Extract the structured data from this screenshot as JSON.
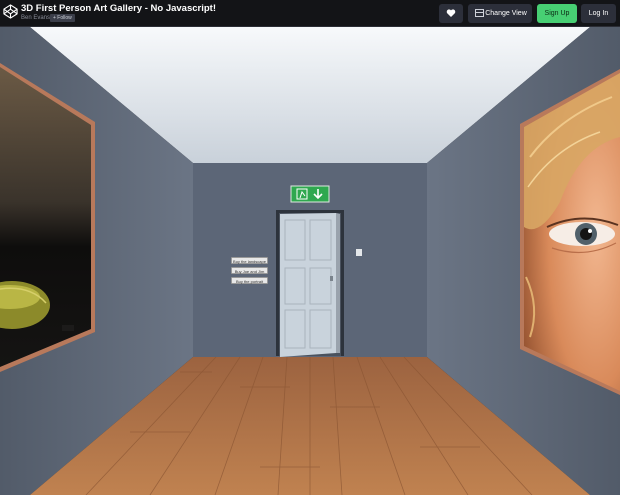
{
  "header": {
    "title": "3D First Person Art Gallery - No Javascript!",
    "author": "Ben Evans",
    "follow_label": "+ Follow",
    "change_view_label": "Change View",
    "signup_label": "Sign Up",
    "login_label": "Log In"
  },
  "gallery": {
    "buttons": [
      "Buy the landscape",
      "Buy Joe and Jim",
      "Buy the portrait"
    ]
  },
  "colors": {
    "signup": "#47cf73",
    "header_bg": "#131417",
    "exit_sign": "#2fa84f",
    "wall": "#5f6a7b",
    "floor": "#b87a4b"
  },
  "icons": [
    "codepen-logo-icon",
    "heart-icon",
    "layout-icon",
    "exit-sign-icon"
  ]
}
